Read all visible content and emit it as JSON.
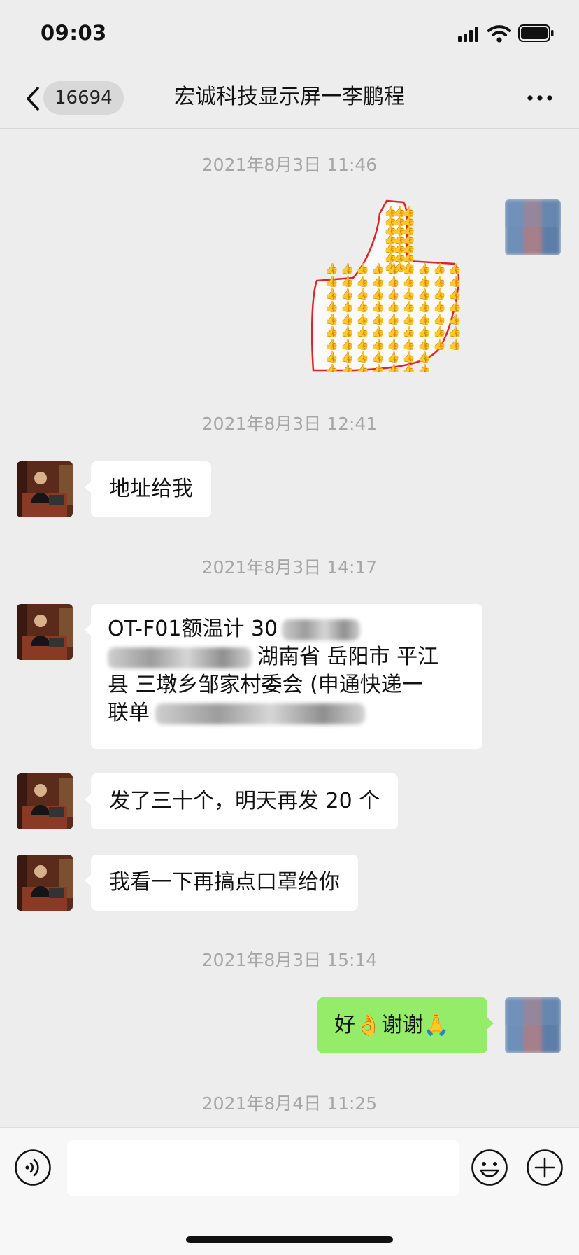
{
  "status_bar": {
    "time": "09:03",
    "icons": [
      "cellular-signal-icon",
      "wifi-icon",
      "battery-icon"
    ]
  },
  "nav": {
    "back_icon": "chevron-left-icon",
    "unread_count": "16694",
    "title": "宏诚科技显示屏一李鹏程",
    "more_icon": "more-horizontal-icon"
  },
  "messages": [
    {
      "type": "timestamp",
      "text": "2021年8月3日 11:46"
    },
    {
      "type": "sticker",
      "side": "right",
      "description_icon": "thumbs-up-sticker"
    },
    {
      "type": "timestamp",
      "text": "2021年8月3日 12:41"
    },
    {
      "type": "text",
      "side": "left",
      "text": "地址给我"
    },
    {
      "type": "timestamp",
      "text": "2021年8月3日 14:17"
    },
    {
      "type": "text",
      "side": "left",
      "lines": [
        "OT-F01额温计 30",
        "湖南省 岳阳市 平江",
        "县 三墩乡邹家村委会 (申通快递一",
        "联单"
      ]
    },
    {
      "type": "text",
      "side": "left",
      "text": "发了三十个，明天再发 20 个"
    },
    {
      "type": "text",
      "side": "left",
      "text": "我看一下再搞点口罩给你"
    },
    {
      "type": "timestamp",
      "text": "2021年8月3日 15:14"
    },
    {
      "type": "text",
      "side": "right",
      "text": "好👌谢谢🙏"
    },
    {
      "type": "timestamp",
      "text": "2021年8月4日 11:25"
    }
  ],
  "input_bar": {
    "voice_icon": "voice-input-icon",
    "input_value": "",
    "emoji_icon": "emoji-icon",
    "plus_icon": "plus-icon"
  },
  "colors": {
    "chat_background": "#ededed",
    "sent_bubble": "#95ec69",
    "received_bubble": "#ffffff",
    "timestamp_text": "#a6a6a6"
  }
}
